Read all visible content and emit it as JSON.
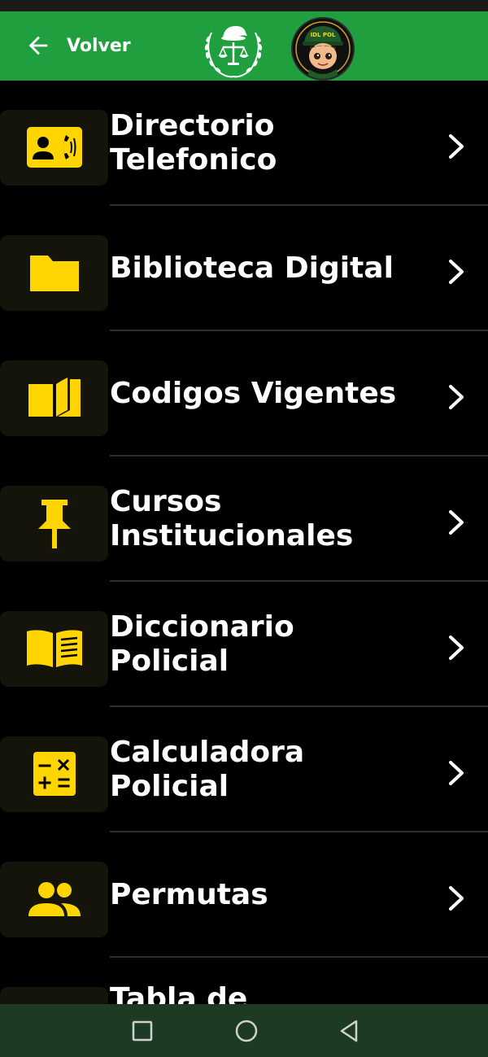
{
  "header": {
    "back_label": "Volver",
    "avatar_text": "IDL POL",
    "bg_color": "#1f9f3d"
  },
  "accent_color": "#ffd500",
  "menu": [
    {
      "label": "Directorio\nTelefonico",
      "icon": "contact-phone-icon"
    },
    {
      "label": "Biblioteca Digital",
      "icon": "folder-icon"
    },
    {
      "label": "Codigos Vigentes",
      "icon": "open-book-icon"
    },
    {
      "label": "Cursos\nInstitucionales",
      "icon": "pushpin-icon"
    },
    {
      "label": "Diccionario\nPolicial",
      "icon": "book-lines-icon"
    },
    {
      "label": "Calculadora\nPolicial",
      "icon": "calculator-icon"
    },
    {
      "label": "Permutas",
      "icon": "people-icon"
    },
    {
      "label": "Tabla de",
      "icon": "card-icon"
    }
  ],
  "nav": {
    "buttons": [
      "recent-apps-icon",
      "home-icon",
      "back-triangle-icon"
    ]
  }
}
